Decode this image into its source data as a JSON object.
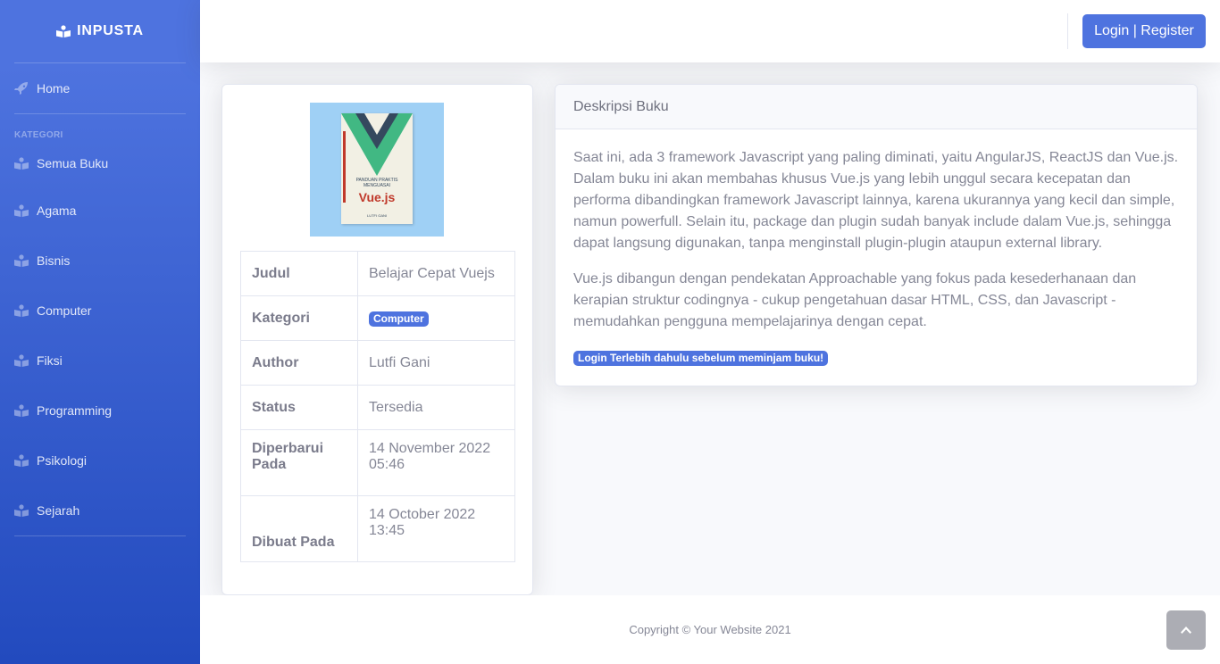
{
  "brand": {
    "name": "INPUSTA",
    "icon": "book-reader-icon"
  },
  "sidebar": {
    "home_label": "Home",
    "heading": "KATEGORI",
    "items": [
      {
        "label": "Semua Buku"
      },
      {
        "label": "Agama"
      },
      {
        "label": "Bisnis"
      },
      {
        "label": "Computer"
      },
      {
        "label": "Fiksi"
      },
      {
        "label": "Programming"
      },
      {
        "label": "Psikologi"
      },
      {
        "label": "Sejarah"
      }
    ]
  },
  "topbar": {
    "login_label": "Login | Register"
  },
  "book": {
    "cover": {
      "line1": "PANDUAN PRAKTIS MENGUASAI",
      "title": "Vue.js",
      "author": "LUTFI GANI"
    },
    "rows": {
      "judul_key": "Judul",
      "judul_val": "Belajar Cepat Vuejs",
      "kategori_key": "Kategori",
      "kategori_val": "Computer",
      "author_key": "Author",
      "author_val": "Lutfi Gani",
      "status_key": "Status",
      "status_val": "Tersedia",
      "updated_key": "Diperbarui Pada",
      "updated_val": "14 November 2022 05:46",
      "created_key": "Dibuat Pada",
      "created_val": "14 October 2022 13:45"
    }
  },
  "description": {
    "header": "Deskripsi Buku",
    "p1": "Saat ini, ada 3 framework Javascript yang paling diminati, yaitu AngularJS, ReactJS dan Vue.js. Dalam buku ini akan membahas khusus Vue.js yang lebih unggul secara kecepatan dan performa dibandingkan framework Javascript lainnya, karena ukurannya yang kecil dan simple, namun powerfull. Selain itu, package dan plugin sudah banyak include dalam Vue.js, sehingga dapat langsung digunakan, tanpa menginstall plugin-plugin ataupun external library.",
    "p2": "Vue.js dibangun dengan pendekatan Approachable yang fokus pada kesederhanaan dan kerapian struktur codingnya - cukup pengetahuan dasar HTML, CSS, dan Javascript - memudahkan pengguna mempelajarinya dengan cepat.",
    "notice": "Login Terlebih dahulu sebelum meminjam buku!"
  },
  "footer": {
    "copyright": "Copyright © Your Website 2021"
  },
  "colors": {
    "primary": "#4e73df",
    "sidebar_end": "#224abe",
    "text": "#858796"
  }
}
